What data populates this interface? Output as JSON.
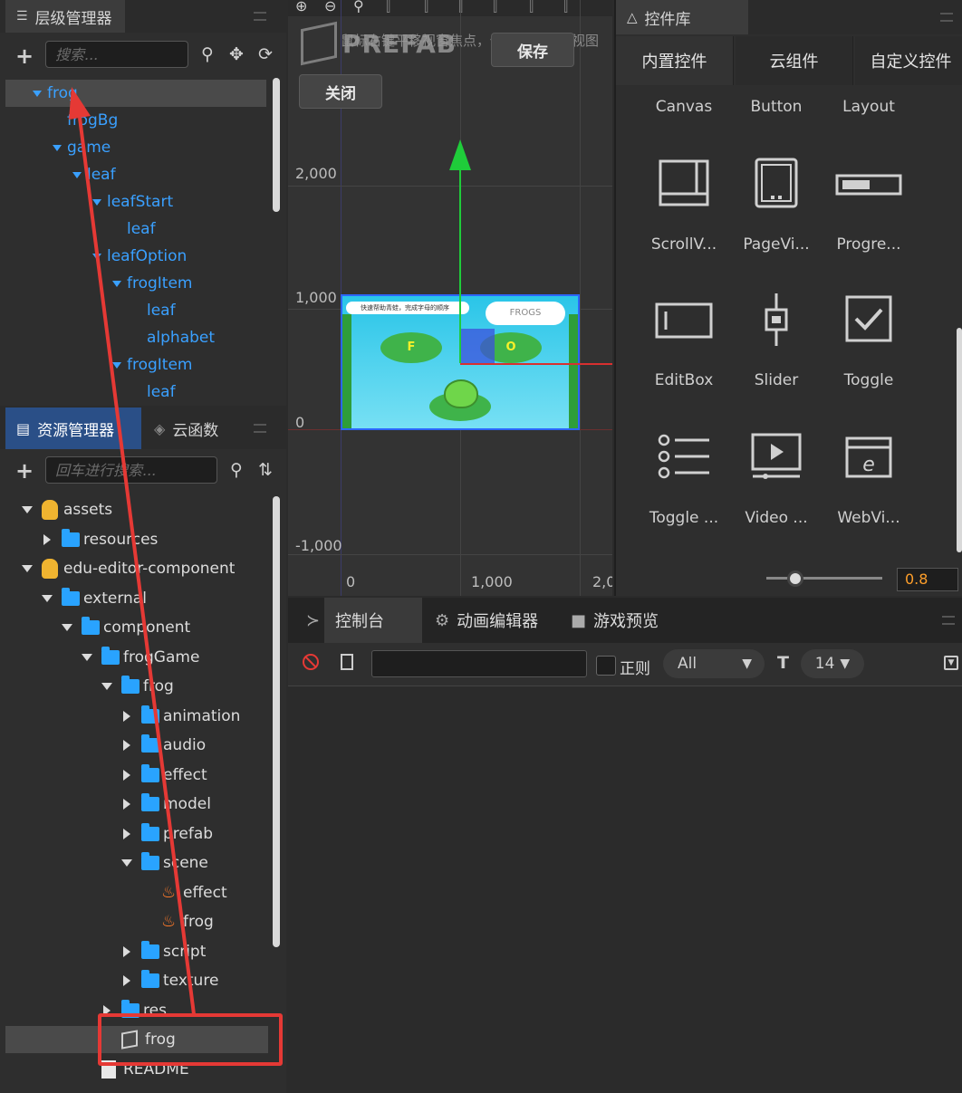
{
  "hierarchy": {
    "title": "层级管理器",
    "search_placeholder": "搜索...",
    "nodes": [
      {
        "label": "frog",
        "depth": 0
      },
      {
        "label": "frogBg",
        "depth": 1
      },
      {
        "label": "game",
        "depth": 1
      },
      {
        "label": "leaf",
        "depth": 2
      },
      {
        "label": "leafStart",
        "depth": 3
      },
      {
        "label": "leaf",
        "depth": 4
      },
      {
        "label": "leafOption",
        "depth": 3
      },
      {
        "label": "frogItem",
        "depth": 4
      },
      {
        "label": "leaf",
        "depth": 5
      },
      {
        "label": "alphabet",
        "depth": 5
      },
      {
        "label": "frogItem",
        "depth": 4
      },
      {
        "label": "leaf",
        "depth": 5
      }
    ]
  },
  "assets": {
    "title": "资源管理器",
    "cloud_tab": "云函数",
    "search_placeholder": "回车进行搜索...",
    "items": [
      {
        "label": "assets",
        "depth": 0,
        "icon": "db",
        "open": true
      },
      {
        "label": "resources",
        "depth": 1,
        "icon": "folder",
        "open": false
      },
      {
        "label": "edu-editor-component",
        "depth": 0,
        "icon": "db",
        "open": true
      },
      {
        "label": "external",
        "depth": 1,
        "icon": "folder",
        "open": true
      },
      {
        "label": "component",
        "depth": 2,
        "icon": "folder",
        "open": true
      },
      {
        "label": "frogGame",
        "depth": 3,
        "icon": "folder",
        "open": true
      },
      {
        "label": "frog",
        "depth": 4,
        "icon": "folder",
        "open": true
      },
      {
        "label": "animation",
        "depth": 5,
        "icon": "folder",
        "open": false
      },
      {
        "label": "audio",
        "depth": 5,
        "icon": "folder",
        "open": false
      },
      {
        "label": "effect",
        "depth": 5,
        "icon": "folder",
        "open": false
      },
      {
        "label": "model",
        "depth": 5,
        "icon": "folder",
        "open": false
      },
      {
        "label": "prefab",
        "depth": 5,
        "icon": "folder",
        "open": false
      },
      {
        "label": "scene",
        "depth": 5,
        "icon": "folder",
        "open": true
      },
      {
        "label": "effect",
        "depth": 6,
        "icon": "fire",
        "open": null
      },
      {
        "label": "frog",
        "depth": 6,
        "icon": "fire",
        "open": null
      },
      {
        "label": "script",
        "depth": 5,
        "icon": "folder",
        "open": false
      },
      {
        "label": "texture",
        "depth": 5,
        "icon": "folder",
        "open": false
      },
      {
        "label": "res",
        "depth": 4,
        "icon": "folder",
        "open": false
      },
      {
        "label": "frog",
        "depth": 4,
        "icon": "prefab",
        "open": null
      },
      {
        "label": "README",
        "depth": 3,
        "icon": "doc",
        "open": null
      }
    ]
  },
  "scene": {
    "prefab_watermark": "PREFAB",
    "hint_text": "鼠标右键平移视窗焦点，使用滚轮缩放视图",
    "save_button": "保存",
    "close_button": "关闭",
    "y_ticks": [
      "2,000",
      "1,000",
      "0",
      "-1,000"
    ],
    "x_ticks": [
      "0",
      "1,000",
      "2,0"
    ],
    "game_preview": {
      "banner": "快速帮助青蛙，完成字母的顺序",
      "frogs_label": "FROGS",
      "pad_left_letter": "F",
      "pad_right_letter": "O"
    }
  },
  "widgets": {
    "title": "控件库",
    "tabs": [
      "内置控件",
      "云组件",
      "自定义控件"
    ],
    "active_tab": 0,
    "top_labels": [
      "Canvas",
      "Button",
      "Layout"
    ],
    "items": [
      {
        "label": "ScrollV...",
        "icon": "scrollview-icon"
      },
      {
        "label": "PageVi...",
        "icon": "pageview-icon"
      },
      {
        "label": "Progre...",
        "icon": "progressbar-icon"
      },
      {
        "label": "EditBox",
        "icon": "editbox-icon"
      },
      {
        "label": "Slider",
        "icon": "slider-icon"
      },
      {
        "label": "Toggle",
        "icon": "toggle-icon"
      },
      {
        "label": "Toggle ...",
        "icon": "togglegroup-icon"
      },
      {
        "label": "Video ...",
        "icon": "videoplayer-icon"
      },
      {
        "label": "WebVi...",
        "icon": "webview-icon"
      }
    ],
    "zoom_value": "0.8",
    "zoom_fraction": 0.25
  },
  "console": {
    "tabs": [
      "控制台",
      "动画编辑器",
      "游戏预览"
    ],
    "regex_label": "正则",
    "level_select": "All",
    "font_size": "14"
  },
  "colors": {
    "accent_blue": "#3aa0ff",
    "highlight_red": "#e53935",
    "folder_blue": "#29a3ff",
    "orange_value": "#ff9f2a"
  }
}
